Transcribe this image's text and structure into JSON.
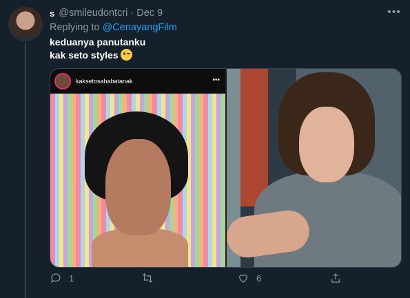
{
  "tweet": {
    "name_glyph": "s",
    "handle": "@smileudontcri",
    "separator": "·",
    "date": "Dec 9",
    "replying_prefix": "Replying to ",
    "replying_to": "@CenayangFilm",
    "text_line1": "keduanya panutanku",
    "text_line2": "kak seto styles",
    "more_icon": "more-icon",
    "more_glyph": "•••"
  },
  "media": {
    "left_image": {
      "ig_username": "kaksetosahabatanak",
      "ig_more_glyph": "•••"
    }
  },
  "actions": {
    "reply_count": "1",
    "retweet_count": "",
    "like_count": "6"
  },
  "colors": {
    "background": "#15202b",
    "secondary_text": "#8899a6",
    "link": "#1da1f2",
    "border": "#38444d"
  }
}
